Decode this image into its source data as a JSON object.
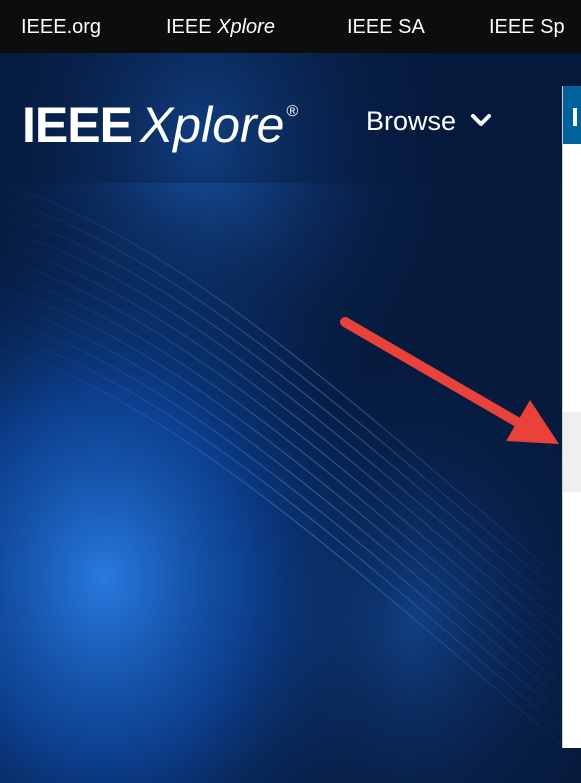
{
  "topbar": {
    "links": [
      {
        "label": "IEEE.org"
      },
      {
        "label_prefix": "IEEE ",
        "label_italic": "Xplore"
      },
      {
        "label": "IEEE SA"
      },
      {
        "label": "IEEE Sp"
      }
    ]
  },
  "header": {
    "logo_ieee": "IEEE",
    "logo_xplore": "Xplore",
    "logo_reg": "®",
    "browse_label": "Browse"
  },
  "colors": {
    "topbar_bg": "#0d0d0d",
    "hero_bg": "#061a3d",
    "panel_accent": "#00629b",
    "arrow": "#e8423b"
  },
  "icons": {
    "browse": "chevron-down-icon",
    "annotation": "red-arrow"
  }
}
